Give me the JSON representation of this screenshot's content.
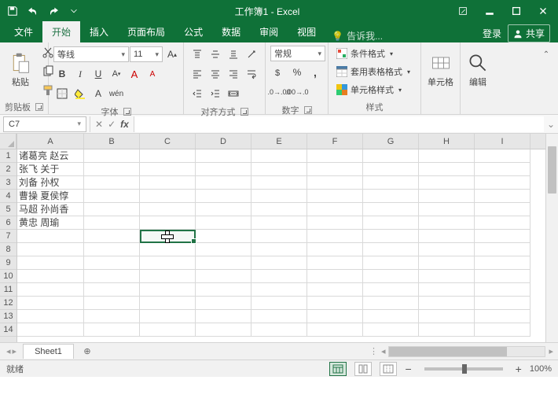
{
  "title": "工作簿1 - Excel",
  "tabs": {
    "file": "文件",
    "home": "开始",
    "insert": "插入",
    "layout": "页面布局",
    "formulas": "公式",
    "data": "数据",
    "review": "审阅",
    "view": "视图"
  },
  "tellme": "告诉我...",
  "login": "登录",
  "share": "共享",
  "ribbon": {
    "clipboard": {
      "paste": "粘贴",
      "label": "剪贴板"
    },
    "font": {
      "name": "等线",
      "size": "11",
      "label": "字体",
      "bold": "B",
      "italic": "I",
      "underline": "U",
      "phonetic": "wén"
    },
    "align": {
      "label": "对齐方式"
    },
    "number": {
      "format": "常规",
      "label": "数字"
    },
    "styles": {
      "cond": "条件格式",
      "table": "套用表格格式",
      "cell": "单元格样式",
      "label": "样式"
    },
    "cells": {
      "label": "单元格"
    },
    "editing": {
      "label": "编辑"
    }
  },
  "namebox": "C7",
  "columns": [
    "A",
    "B",
    "C",
    "D",
    "E",
    "F",
    "G",
    "H",
    "I"
  ],
  "rows": [
    "1",
    "2",
    "3",
    "4",
    "5",
    "6",
    "7",
    "8",
    "9",
    "10",
    "11",
    "12",
    "13",
    "14"
  ],
  "data_cells": {
    "A1": "诸葛亮 赵云",
    "A2": "张飞 关于",
    "A3": "刘备 孙权",
    "A4": "曹操 夏侯惇",
    "A5": "马超 孙尚香",
    "A6": "黄忠 周瑜"
  },
  "sheet_tab": "Sheet1",
  "status": {
    "ready": "就绪",
    "zoom": "100%"
  }
}
